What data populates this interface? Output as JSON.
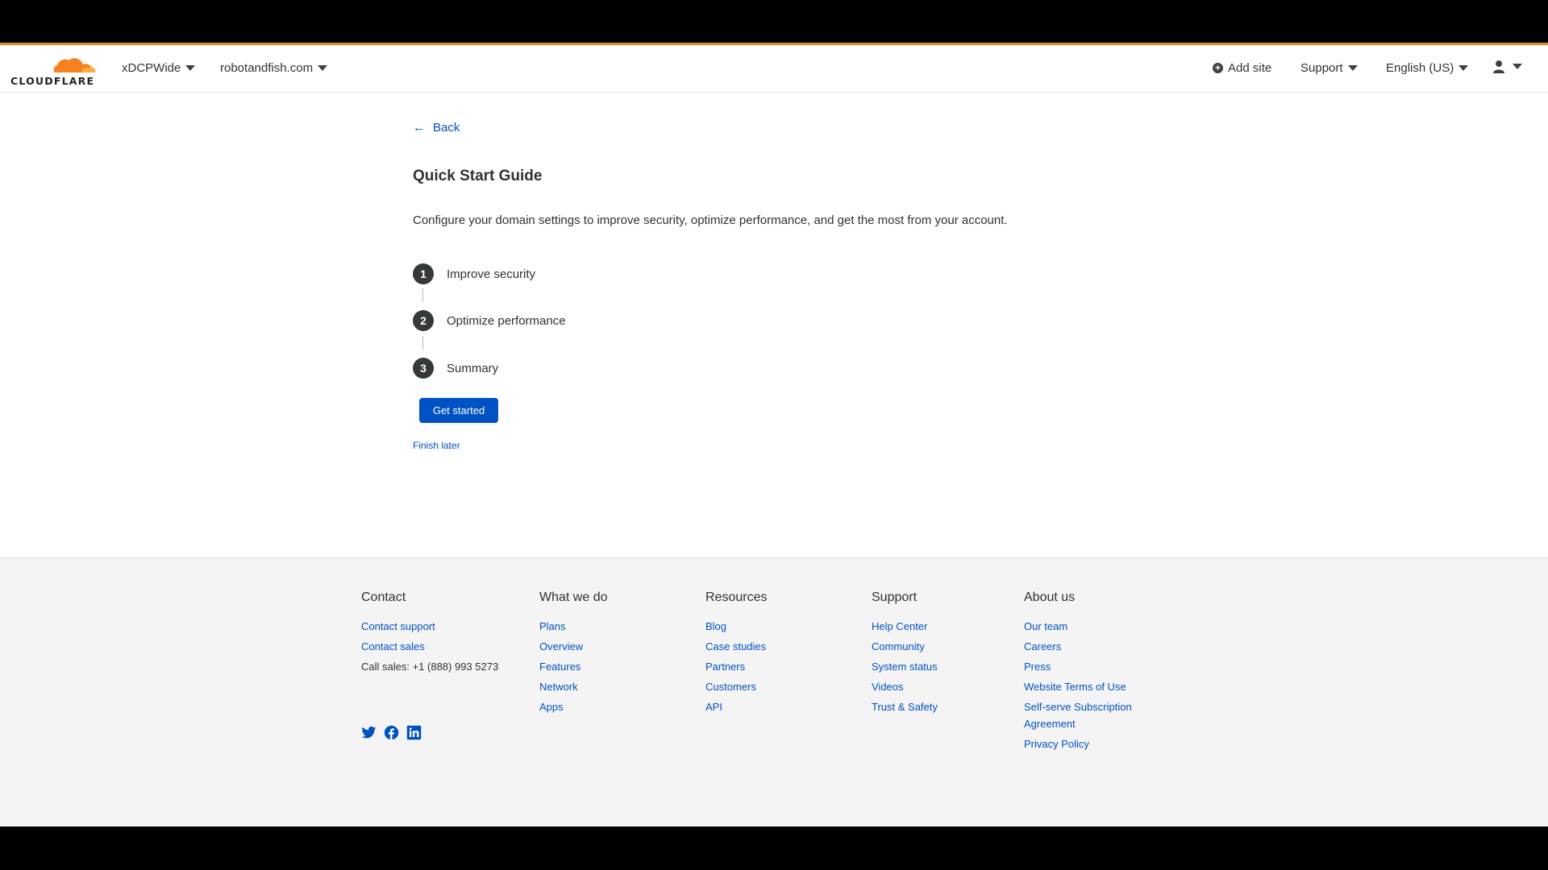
{
  "header": {
    "logo_text": "CLOUDFLARE",
    "account_label": "xDCPWide",
    "domain_label": "robotandfish.com",
    "add_site_label": "Add site",
    "support_label": "Support",
    "language_label": "English (US)"
  },
  "main": {
    "back_label": "Back",
    "title": "Quick Start Guide",
    "description": "Configure your domain settings to improve security, optimize performance, and get the most from your account.",
    "steps": [
      {
        "number": "1",
        "label": "Improve security"
      },
      {
        "number": "2",
        "label": "Optimize performance"
      },
      {
        "number": "3",
        "label": "Summary"
      }
    ],
    "get_started_label": "Get started",
    "finish_later_label": "Finish later"
  },
  "footer": {
    "contact": {
      "heading": "Contact",
      "links": [
        "Contact support",
        "Contact sales"
      ],
      "call_sales": "Call sales: +1 (888) 993 5273"
    },
    "what_we_do": {
      "heading": "What we do",
      "links": [
        "Plans",
        "Overview",
        "Features",
        "Network",
        "Apps"
      ]
    },
    "resources": {
      "heading": "Resources",
      "links": [
        "Blog",
        "Case studies",
        "Partners",
        "Customers",
        "API"
      ]
    },
    "support": {
      "heading": "Support",
      "links": [
        "Help Center",
        "Community",
        "System status",
        "Videos",
        "Trust & Safety"
      ]
    },
    "about_us": {
      "heading": "About us",
      "links": [
        "Our team",
        "Careers",
        "Press",
        "Website Terms of Use",
        "Self-serve Subscription Agreement",
        "Privacy Policy"
      ]
    },
    "social_icons": [
      "twitter-icon",
      "facebook-icon",
      "linkedin-icon"
    ]
  },
  "colors": {
    "accent_orange": "#f6821f",
    "link_blue": "#0051c3",
    "button_blue": "#0051c3",
    "step_circle": "#36393a",
    "footer_bg": "#f4f4f4"
  }
}
